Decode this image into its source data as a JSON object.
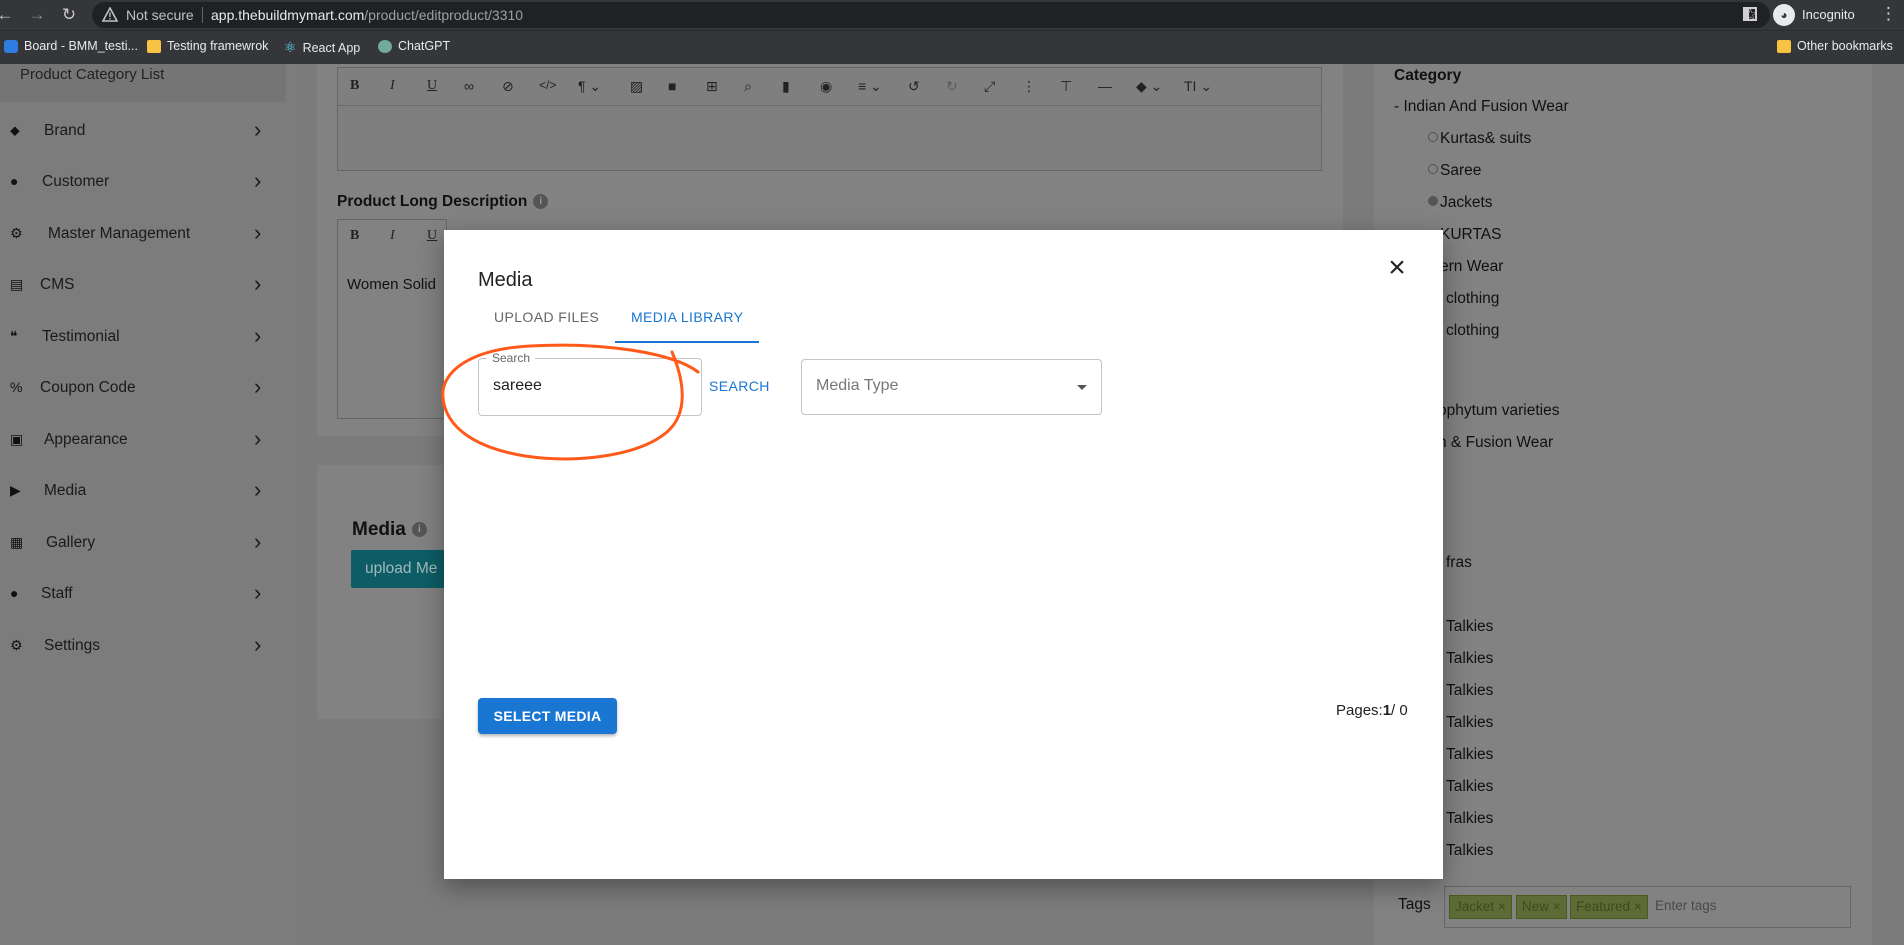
{
  "browser": {
    "security_label": "Not secure",
    "url_host": "app.thebuildmymart.com",
    "url_path": "/product/editproduct/3310",
    "incognito_label": "Incognito",
    "bookmarks": [
      "Board - BMM_testi...",
      "Testing framewrok",
      "React App",
      "ChatGPT"
    ],
    "other_bookmarks": "Other bookmarks"
  },
  "sidebar": {
    "top_item": "Product Category List",
    "items": [
      {
        "label": "Brand",
        "icon": "tag-icon"
      },
      {
        "label": "Customer",
        "icon": "person-icon"
      },
      {
        "label": "Master Management",
        "icon": "user-gear-icon"
      },
      {
        "label": "CMS",
        "icon": "document-icon"
      },
      {
        "label": "Testimonial",
        "icon": "quote-icon"
      },
      {
        "label": "Coupon Code",
        "icon": "percent-icon"
      },
      {
        "label": "Appearance",
        "icon": "image-icon"
      },
      {
        "label": "Media",
        "icon": "play-circle-icon"
      },
      {
        "label": "Gallery",
        "icon": "gallery-icon"
      },
      {
        "label": "Staff",
        "icon": "person-icon"
      },
      {
        "label": "Settings",
        "icon": "gear-icon"
      }
    ]
  },
  "editor": {
    "toolbar": [
      "B",
      "I",
      "U"
    ],
    "long_description_label": "Product Long Description",
    "long_description_text": "Women Solid"
  },
  "media_section": {
    "title": "Media",
    "upload_button": "upload Me"
  },
  "category": {
    "title": "Category",
    "items": [
      {
        "label": "- Indian And Fusion Wear",
        "radio": null
      },
      {
        "label": "Kurtas& suits",
        "radio": "off"
      },
      {
        "label": "Saree",
        "radio": "off"
      },
      {
        "label": "Jackets",
        "radio": "on"
      },
      {
        "label": "KURTAS",
        "radio": null
      },
      {
        "label": "ern Wear",
        "radio": null
      },
      {
        "label": "clothing",
        "radio": null
      },
      {
        "label": "clothing",
        "radio": null
      },
      {
        "label": "ophytum varieties",
        "radio": null
      },
      {
        "label": "n & Fusion Wear",
        "radio": null
      },
      {
        "label": "fras",
        "radio": null
      },
      {
        "label": "Talkies",
        "radio": null
      },
      {
        "label": "Talkies",
        "radio": null
      },
      {
        "label": "Talkies",
        "radio": null
      },
      {
        "label": "Talkies",
        "radio": null
      },
      {
        "label": "Talkies",
        "radio": null
      },
      {
        "label": "Talkies",
        "radio": null
      },
      {
        "label": "Talkies",
        "radio": null
      },
      {
        "label": "Talkies",
        "radio": null
      }
    ]
  },
  "tags": {
    "label": "Tags",
    "chips": [
      "Jacket ×",
      "New ×",
      "Featured ×"
    ],
    "placeholder": "Enter tags"
  },
  "modal": {
    "title": "Media",
    "tabs": [
      "UPLOAD FILES",
      "MEDIA LIBRARY"
    ],
    "active_tab": "MEDIA LIBRARY",
    "search_label": "Search",
    "search_value": "sareee",
    "search_button": "SEARCH",
    "media_type_placeholder": "Media Type",
    "select_button": "SELECT MEDIA",
    "pages_prefix": "Pages:",
    "pages_current": "1",
    "pages_total": "/ 0"
  },
  "colors": {
    "accent": "#1976d2",
    "annotation": "#ff5a1a",
    "chrome": "#35363a"
  }
}
